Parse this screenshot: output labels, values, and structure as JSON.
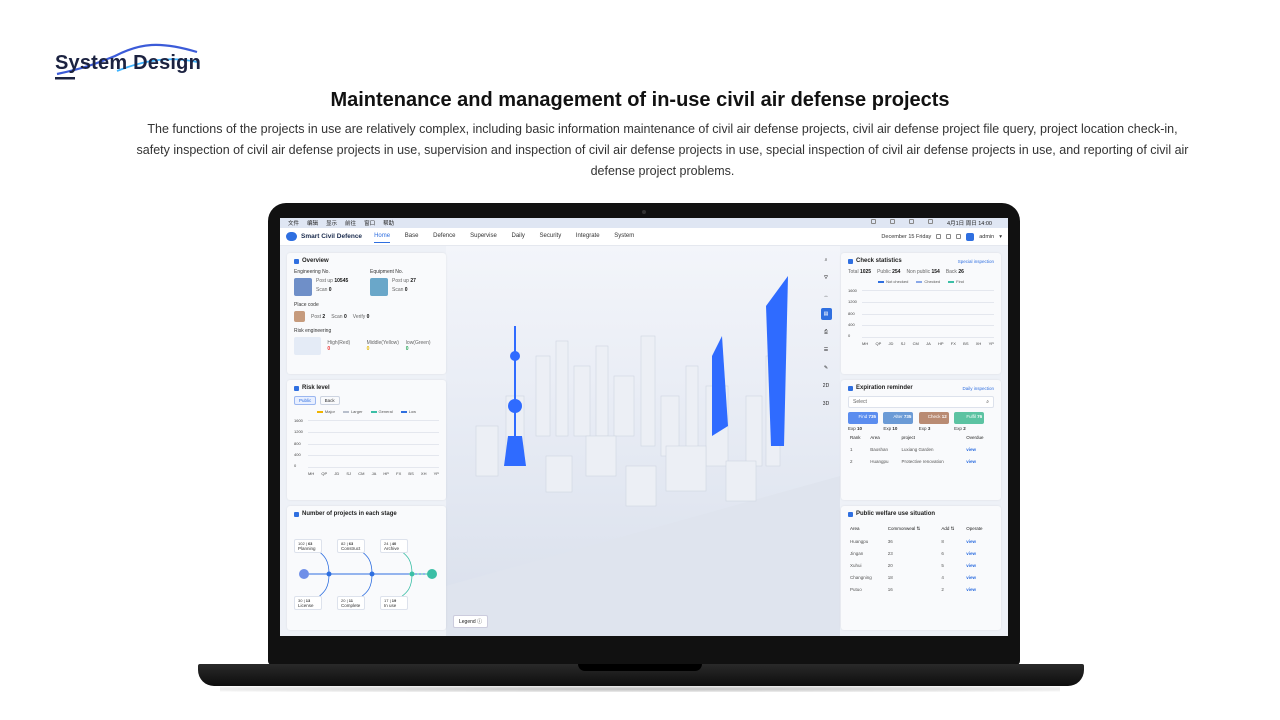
{
  "brand": {
    "name": "System Design"
  },
  "headline": "Maintenance and management of in-use civil air defense projects",
  "description": "The functions of the projects in use are relatively complex, including basic information maintenance of civil air defense projects, civil air defense project file query, project location check-in, safety inspection of civil air defense projects in use, supervision and inspection of civil air defense projects in use, special inspection of civil air defense projects in use, and reporting of civil air defense project problems.",
  "macbar": {
    "menus": [
      "文件",
      "编辑",
      "显示",
      "前往",
      "窗口",
      "帮助"
    ],
    "datetime": "4月1日 周日 14:00"
  },
  "app": {
    "name": "Smart Civil Defence",
    "nav": [
      "Home",
      "Base",
      "Defence",
      "Supervise",
      "Daily",
      "Security",
      "Integrate",
      "System"
    ],
    "date": "December 15  Friday",
    "user": "admin"
  },
  "overview": {
    "title": "Overview",
    "engineering": {
      "label": "Engineering No.",
      "post_label": "Post up",
      "post": "10545",
      "scan_label": "Scan",
      "scan": "0"
    },
    "equipment": {
      "label": "Equipment No.",
      "post_label": "Post up",
      "post": "27",
      "scan_label": "Scan",
      "scan": "0"
    },
    "place": {
      "label": "Place code",
      "post_label": "Post",
      "post": "2",
      "scan_label": "Scan",
      "scan": "0",
      "verify_label": "Verify",
      "verify": "0"
    },
    "risk": {
      "label": "Risk engineering",
      "high_label": "High(Red)",
      "high": "0",
      "middle_label": "Middle(Yellow)",
      "middle": "0",
      "low_label": "low(Green)",
      "low": "0"
    }
  },
  "risk_level": {
    "title": "Risk level",
    "tabs": [
      "Public",
      "Back"
    ],
    "legend": [
      "Major",
      "Larger",
      "General",
      "Low"
    ],
    "yticks": [
      "1600",
      "1200",
      "800",
      "400",
      "0"
    ],
    "xticks": [
      "MH",
      "QP",
      "JD",
      "SJ",
      "CM",
      "JA",
      "HP",
      "FX",
      "BS",
      "XH",
      "YP"
    ]
  },
  "stages": {
    "title": "Number of projects in each stage",
    "items": [
      {
        "label": "Planning",
        "a": "102",
        "b": "63"
      },
      {
        "label": "Construct",
        "a": "82",
        "b": "63"
      },
      {
        "label": "Archive",
        "a": "24",
        "b": "40"
      },
      {
        "label": "License",
        "a": "30",
        "b": "13"
      },
      {
        "label": "Complete",
        "a": "20",
        "b": "11"
      },
      {
        "label": "In use",
        "a": "17",
        "b": "19"
      }
    ]
  },
  "map": {
    "legend": "Legend",
    "tools": [
      "2D",
      "3D"
    ]
  },
  "check": {
    "title": "Check statistics",
    "link": "Special inspection",
    "total_label": "Total",
    "total": "1025",
    "public_label": "Public",
    "public": "254",
    "nonpublic_label": "Non public",
    "nonpublic": "154",
    "back_label": "Back",
    "back": "26",
    "legend": [
      "Not checked",
      "Checked",
      "Find"
    ],
    "yticks": [
      "1600",
      "1200",
      "800",
      "400",
      "0"
    ],
    "xticks": [
      "MH",
      "QP",
      "JD",
      "SJ",
      "CM",
      "JA",
      "HP",
      "FX",
      "BS",
      "XH",
      "YP"
    ]
  },
  "expiration": {
    "title": "Expiration reminder",
    "link": "Daily inspection",
    "select_placeholder": "Select",
    "cards": [
      {
        "name": "Find",
        "value": "735",
        "exp_label": "Exp",
        "exp": "10",
        "color": "#5b8def"
      },
      {
        "name": "Alter",
        "value": "735",
        "exp_label": "Exp",
        "exp": "10",
        "color": "#6b9bd6"
      },
      {
        "name": "Check",
        "value": "12",
        "exp_label": "Exp",
        "exp": "3",
        "color": "#b98b73"
      },
      {
        "name": "Fulfil",
        "value": "76",
        "exp_label": "Exp",
        "exp": "2",
        "color": "#5cc3a2"
      }
    ],
    "headers": [
      "Rank",
      "Area",
      "project",
      "Overdue"
    ],
    "rows": [
      {
        "rank": "1",
        "area": "Baoshan",
        "project": "Luxiang Garden",
        "action": "view"
      },
      {
        "rank": "2",
        "area": "Huangpu",
        "project": "Protective renovation",
        "action": "view"
      }
    ]
  },
  "welfare": {
    "title": "Public welfare use situation",
    "headers": [
      "Area",
      "Commonweal  ⇅",
      "Add  ⇅",
      "Operate"
    ],
    "rows": [
      {
        "area": "Huangpu",
        "c": "36",
        "add": "8",
        "action": "view"
      },
      {
        "area": "Jingan",
        "c": "23",
        "add": "6",
        "action": "view"
      },
      {
        "area": "Xuhui",
        "c": "20",
        "add": "5",
        "action": "view"
      },
      {
        "area": "Changning",
        "c": "18",
        "add": "4",
        "action": "view"
      },
      {
        "area": "Putuo",
        "c": "16",
        "add": "2",
        "action": "view"
      }
    ]
  }
}
